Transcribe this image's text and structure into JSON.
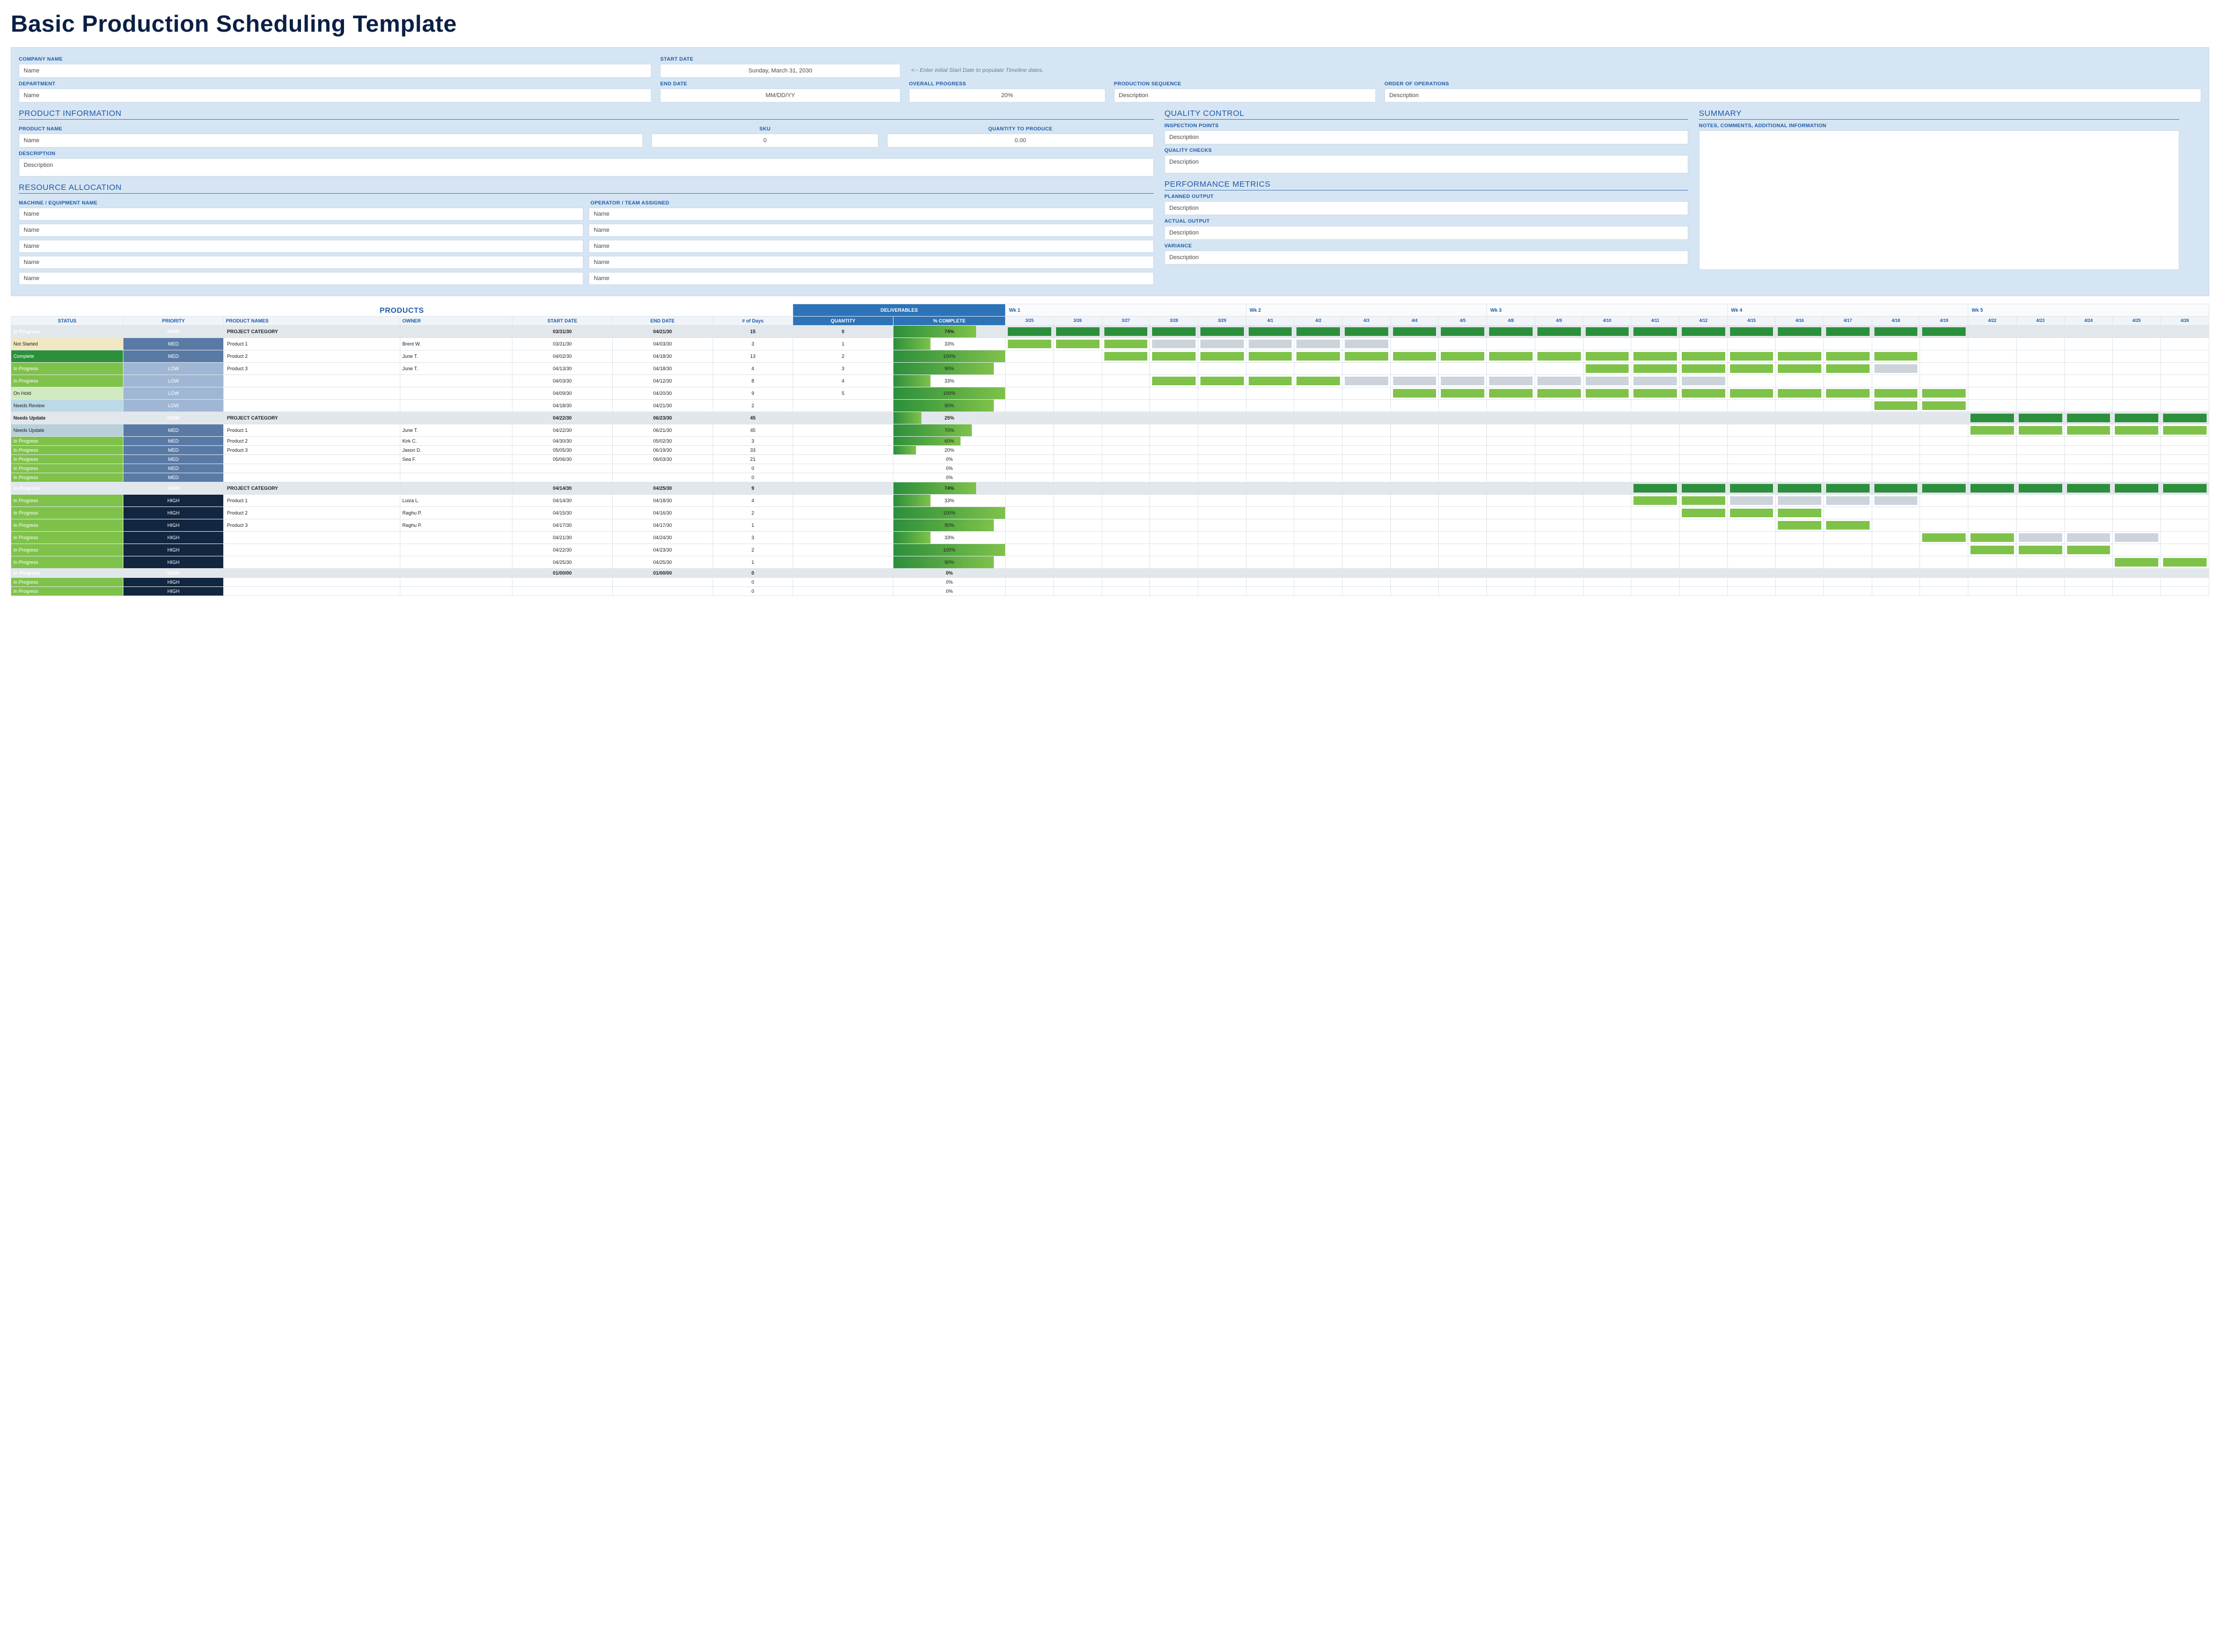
{
  "title": "Basic Production Scheduling Template",
  "top": {
    "company_name_label": "COMPANY NAME",
    "company_name": "Name",
    "start_date_label": "START DATE",
    "start_date": "Sunday, March 31, 2030",
    "hint": "<-- Enter initial Start Date to populate Timeline dates.",
    "department_label": "DEPARTMENT",
    "department": "Name",
    "end_date_label": "END DATE",
    "end_date": "MM/DD/YY",
    "overall_progress_label": "OVERALL PROGRESS",
    "overall_progress": "20%",
    "production_sequence_label": "PRODUCTION SEQUENCE",
    "production_sequence": "Description",
    "order_ops_label": "ORDER OF OPERATIONS",
    "order_ops": "Description"
  },
  "product_info": {
    "title": "PRODUCT INFORMATION",
    "product_name_label": "PRODUCT NAME",
    "product_name": "Name",
    "sku_label": "SKU",
    "sku": "0",
    "qtp_label": "QUANTITY TO PRODUCE",
    "qtp": "0.00",
    "description_label": "DESCRIPTION",
    "description": "Description"
  },
  "resource": {
    "title": "RESOURCE ALLOCATION",
    "machine_label": "MACHINE / EQUIPMENT NAME",
    "operator_label": "OPERATOR / TEAM ASSIGNED",
    "rows": [
      {
        "m": "Name",
        "o": "Name"
      },
      {
        "m": "Name",
        "o": "Name"
      },
      {
        "m": "Name",
        "o": "Name"
      },
      {
        "m": "Name",
        "o": "Name"
      },
      {
        "m": "Name",
        "o": "Name"
      }
    ]
  },
  "qc": {
    "title": "QUALITY CONTROL",
    "inspection_label": "INSPECTION POINTS",
    "inspection": "Description",
    "checks_label": "QUALITY CHECKS",
    "checks": "Description"
  },
  "perf": {
    "title": "PERFORMANCE METRICS",
    "planned_label": "PLANNED OUTPUT",
    "planned": "Description",
    "actual_label": "ACTUAL OUTPUT",
    "actual": "Description",
    "variance_label": "VARIANCE",
    "variance": "Description"
  },
  "summary": {
    "title": "SUMMARY",
    "notes_label": "NOTES, COMMENTS, ADDITIONAL INFORMATION"
  },
  "table": {
    "products_hd": "PRODUCTS",
    "deliverables_hd": "DELIVERABLES",
    "cols": {
      "status": "STATUS",
      "priority": "PRIORITY",
      "names": "PRODUCT NAMES",
      "owner": "OWNER",
      "start": "START DATE",
      "end": "END DATE",
      "days": "# of Days",
      "qty": "QUANTITY",
      "pc": "% COMPLETE"
    },
    "weeks": [
      "Wk 1",
      "Wk 2",
      "Wk 3",
      "Wk 4",
      "Wk 5"
    ],
    "dates": [
      "3/25",
      "3/26",
      "3/27",
      "3/28",
      "3/29",
      "4/1",
      "4/2",
      "4/3",
      "4/4",
      "4/5",
      "4/8",
      "4/9",
      "4/10",
      "4/11",
      "4/12",
      "4/15",
      "4/16",
      "4/17",
      "4/18",
      "4/19",
      "4/22",
      "4/23",
      "4/24",
      "4/25",
      "4/26"
    ],
    "rows": [
      {
        "cat": true,
        "status": "In Progress",
        "pri": "HIGH",
        "name": "PROJECT CATEGORY",
        "owner": "",
        "start": "03/31/30",
        "end": "04/21/30",
        "days": "15",
        "qty": "0",
        "pc": 74,
        "bar": [
          0,
          19,
          "dgreen"
        ]
      },
      {
        "status": "Not Started",
        "pri": "MED",
        "name": "Product 1",
        "owner": "Brent W.",
        "start": "03/31/30",
        "end": "04/03/30",
        "days": "3",
        "qty": "1",
        "pc": 33,
        "bar": [
          0,
          7,
          "green"
        ],
        "partial": [
          0,
          2
        ]
      },
      {
        "status": "Complete",
        "pri": "MED",
        "name": "Product 2",
        "owner": "June T.",
        "start": "04/02/30",
        "end": "04/18/30",
        "days": "13",
        "qty": "2",
        "pc": 100,
        "bar": [
          2,
          18,
          "green"
        ],
        "partial": [
          2,
          18
        ]
      },
      {
        "status": "In Progress",
        "pri": "LOW",
        "name": "Product 3",
        "owner": "June T.",
        "start": "04/13/30",
        "end": "04/18/30",
        "days": "4",
        "qty": "3",
        "pc": 90,
        "bar": [
          12,
          18,
          "green"
        ],
        "partial": [
          12,
          17
        ]
      },
      {
        "status": "In Progress",
        "pri": "LOW",
        "name": "",
        "owner": "",
        "start": "04/03/30",
        "end": "04/12/30",
        "days": "8",
        "qty": "4",
        "pc": 33,
        "bar": [
          3,
          14,
          "green"
        ],
        "partial": [
          3,
          6
        ]
      },
      {
        "status": "On Hold",
        "pri": "LOW",
        "name": "",
        "owner": "",
        "start": "04/09/30",
        "end": "04/20/30",
        "days": "9",
        "qty": "5",
        "pc": 100,
        "bar": [
          8,
          19,
          "green"
        ],
        "partial": [
          8,
          19
        ]
      },
      {
        "status": "Needs Review",
        "pri": "LOW",
        "name": "",
        "owner": "",
        "start": "04/18/30",
        "end": "04/21/30",
        "days": "2",
        "qty": "",
        "pc": 90,
        "bar": [
          18,
          19,
          "green"
        ],
        "partial": [
          18,
          19
        ]
      },
      {
        "cat": true,
        "status": "Needs Update",
        "pri": "HIGH",
        "name": "PROJECT CATEGORY",
        "owner": "",
        "start": "04/22/30",
        "end": "06/23/30",
        "days": "45",
        "qty": "",
        "pc": 25,
        "bar": [
          20,
          24,
          "dgreen"
        ]
      },
      {
        "status": "Needs Update",
        "pri": "MED",
        "name": "Product 1",
        "owner": "June T.",
        "start": "04/22/30",
        "end": "06/21/30",
        "days": "45",
        "qty": "",
        "pc": 70,
        "bar": [
          20,
          24,
          "green"
        ],
        "partial": [
          20,
          24
        ]
      },
      {
        "status": "In Progress",
        "pri": "MED",
        "name": "Product 2",
        "owner": "Kirk C.",
        "start": "04/30/30",
        "end": "05/02/30",
        "days": "3",
        "qty": "",
        "pc": 60
      },
      {
        "status": "In Progress",
        "pri": "MED",
        "name": "Product 3",
        "owner": "Jason D.",
        "start": "05/05/30",
        "end": "06/19/30",
        "days": "33",
        "qty": "",
        "pc": 20
      },
      {
        "status": "In Progress",
        "pri": "MED",
        "name": "",
        "owner": "Sea F.",
        "start": "05/06/30",
        "end": "06/03/30",
        "days": "21",
        "qty": "",
        "pc": 0
      },
      {
        "status": "In Progress",
        "pri": "MED",
        "name": "",
        "owner": "",
        "start": "",
        "end": "",
        "days": "0",
        "qty": "",
        "pc": 0
      },
      {
        "status": "In Progress",
        "pri": "MED",
        "name": "",
        "owner": "",
        "start": "",
        "end": "",
        "days": "0",
        "qty": "",
        "pc": 0
      },
      {
        "cat": true,
        "status": "In Progress",
        "pri": "HIGH",
        "name": "PROJECT CATEGORY",
        "owner": "",
        "start": "04/14/30",
        "end": "04/25/30",
        "days": "9",
        "qty": "",
        "pc": 74,
        "bar": [
          13,
          24,
          "dgreen"
        ]
      },
      {
        "status": "In Progress",
        "pri": "HIGH",
        "name": "Product 1",
        "owner": "Luiza L.",
        "start": "04/14/30",
        "end": "04/18/30",
        "days": "4",
        "qty": "",
        "pc": 33,
        "bar": [
          13,
          18,
          "green"
        ],
        "partial": [
          13,
          14
        ]
      },
      {
        "status": "In Progress",
        "pri": "HIGH",
        "name": "Product 2",
        "owner": "Raghu P.",
        "start": "04/15/30",
        "end": "04/16/30",
        "days": "2",
        "qty": "",
        "pc": 100,
        "bar": [
          14,
          16,
          "green"
        ],
        "partial": [
          14,
          16
        ]
      },
      {
        "status": "In Progress",
        "pri": "HIGH",
        "name": "Product 3",
        "owner": "Raghu P.",
        "start": "04/17/30",
        "end": "04/17/30",
        "days": "1",
        "qty": "",
        "pc": 90,
        "bar": [
          16,
          17,
          "green"
        ],
        "partial": [
          16,
          17
        ]
      },
      {
        "status": "In Progress",
        "pri": "HIGH",
        "name": "",
        "owner": "",
        "start": "04/21/30",
        "end": "04/24/30",
        "days": "3",
        "qty": "",
        "pc": 33,
        "bar": [
          19,
          23,
          "green"
        ],
        "partial": [
          19,
          20
        ]
      },
      {
        "status": "In Progress",
        "pri": "HIGH",
        "name": "",
        "owner": "",
        "start": "04/22/30",
        "end": "04/23/30",
        "days": "2",
        "qty": "",
        "pc": 100,
        "bar": [
          20,
          22,
          "green"
        ],
        "partial": [
          20,
          22
        ]
      },
      {
        "status": "In Progress",
        "pri": "HIGH",
        "name": "",
        "owner": "",
        "start": "04/25/30",
        "end": "04/25/30",
        "days": "1",
        "qty": "",
        "pc": 90,
        "bar": [
          23,
          24,
          "green"
        ],
        "partial": [
          23,
          24
        ]
      },
      {
        "cat": true,
        "status": "In Progress",
        "pri": "HIGH",
        "name": "",
        "owner": "",
        "start": "01/00/00",
        "end": "01/00/00",
        "days": "0",
        "qty": "",
        "pc": 0
      },
      {
        "status": "In Progress",
        "pri": "HIGH",
        "name": "",
        "owner": "",
        "start": "",
        "end": "",
        "days": "0",
        "qty": "",
        "pc": 0
      },
      {
        "status": "In Progress",
        "pri": "HIGH",
        "name": "",
        "owner": "",
        "start": "",
        "end": "",
        "days": "0",
        "qty": "",
        "pc": 0
      }
    ]
  }
}
